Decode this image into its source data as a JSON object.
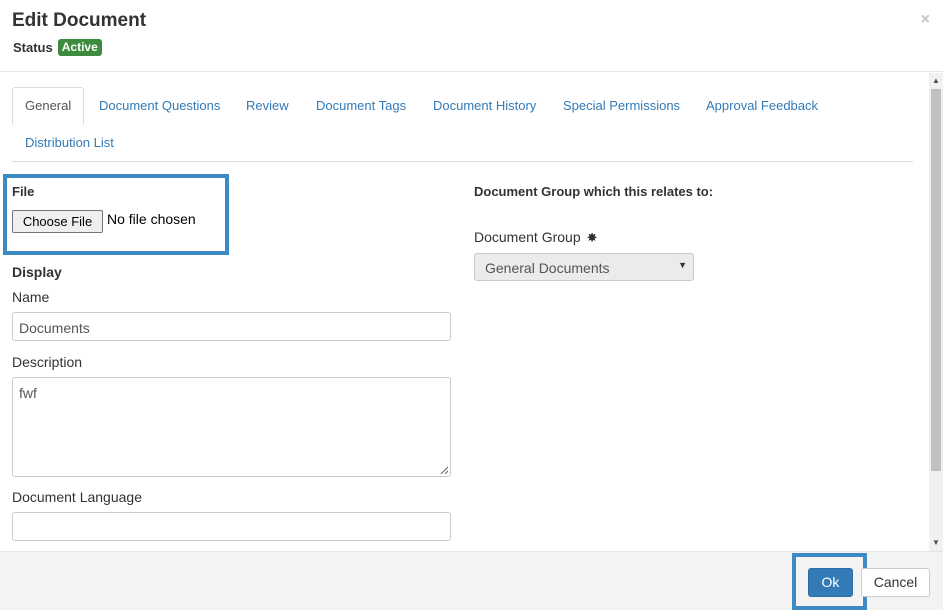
{
  "header": {
    "title": "Edit Document",
    "status_label": "Status",
    "status_value": "Active",
    "close_glyph": "×"
  },
  "tabs": [
    {
      "label": "General",
      "active": true
    },
    {
      "label": "Document Questions"
    },
    {
      "label": "Review"
    },
    {
      "label": "Document Tags"
    },
    {
      "label": "Document History"
    },
    {
      "label": "Special Permissions"
    },
    {
      "label": "Approval Feedback"
    },
    {
      "label": "Distribution List"
    }
  ],
  "form": {
    "file_label": "File",
    "choose_file_label": "Choose File",
    "no_file_text": "No file chosen",
    "display_label": "Display",
    "name_label": "Name",
    "name_value": "Documents",
    "description_label": "Description",
    "description_value": "fwf",
    "language_label": "Document Language",
    "language_value": "",
    "group_heading": "Document Group which this relates to:",
    "group_label": "Document Group",
    "required_glyph": "✸",
    "group_selected": "General Documents",
    "caret_glyph": "▼"
  },
  "footer": {
    "ok_label": "Ok",
    "cancel_label": "Cancel"
  },
  "scrollbar": {
    "up_glyph": "▲",
    "down_glyph": "▼"
  },
  "colors": {
    "accent": "#337ab7",
    "highlight": "#3d8bc4",
    "status": "#3d8b3d"
  }
}
